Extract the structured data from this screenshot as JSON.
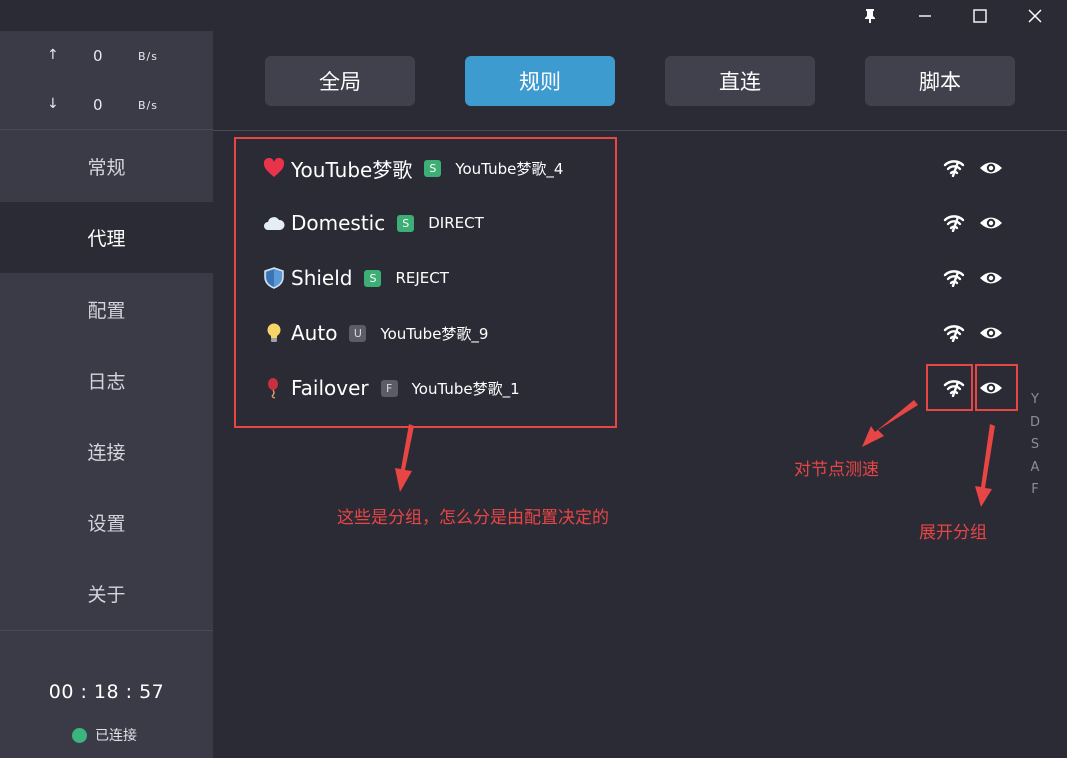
{
  "window": {
    "controls": [
      "pin-icon",
      "minimize-icon",
      "maximize-icon",
      "close-icon"
    ]
  },
  "traffic": {
    "up": {
      "arrow": "↑",
      "value": "0",
      "unit": "B/s"
    },
    "down": {
      "arrow": "↓",
      "value": "0",
      "unit": "B/s"
    }
  },
  "nav": {
    "items": [
      "常规",
      "代理",
      "配置",
      "日志",
      "连接",
      "设置",
      "关于"
    ],
    "active_index": 1
  },
  "status": {
    "uptime": "00 : 18 : 57",
    "connection": "已连接",
    "connection_color": "#3cb47d"
  },
  "modes": {
    "buttons": [
      "全局",
      "规则",
      "直连",
      "脚本"
    ],
    "active": "规则",
    "active_color": "#3d9bd0"
  },
  "groups": [
    {
      "icon": "heart-icon",
      "name": "YouTube梦歌",
      "badge": "S",
      "node": "YouTube梦歌_4"
    },
    {
      "icon": "cloud-icon",
      "name": "Domestic",
      "badge": "S",
      "node": "DIRECT"
    },
    {
      "icon": "shield-icon",
      "name": "Shield",
      "badge": "S",
      "node": "REJECT"
    },
    {
      "icon": "lightbulb-icon",
      "name": "Auto",
      "badge": "U",
      "node": "YouTube梦歌_9"
    },
    {
      "icon": "balloon-icon",
      "name": "Failover",
      "badge": "F",
      "node": "YouTube梦歌_1"
    }
  ],
  "row_actions": [
    "speed-test-icon",
    "eye-icon"
  ],
  "side_index": [
    "Y",
    "D",
    "S",
    "A",
    "F"
  ],
  "annotations": {
    "groups_note": "这些是分组，怎么分是由配置决定的",
    "speed_test_note": "对节点测速",
    "expand_note": "展开分组",
    "color": "#e84545"
  }
}
